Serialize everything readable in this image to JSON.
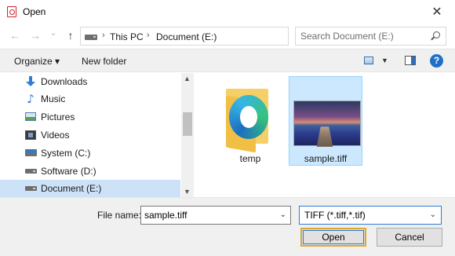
{
  "window": {
    "title": "Open",
    "close_symbol": "✕"
  },
  "nav": {
    "back_symbol": "←",
    "forward_symbol": "→",
    "recent_symbol": "⌄",
    "up_symbol": "↑",
    "breadcrumb": [
      "This PC",
      "Document (E:)"
    ],
    "crumb_separator": "›",
    "dropdown_symbol": "⌄",
    "refresh_symbol": "↻",
    "search_placeholder": "Search Document (E:)"
  },
  "toolbar": {
    "organize_label": "Organize ▾",
    "new_folder_label": "New folder",
    "view_dropdown_symbol": "▼",
    "help_symbol": "?"
  },
  "sidebar": {
    "items": [
      {
        "label": "Downloads",
        "icon": "downloads-icon",
        "selected": false
      },
      {
        "label": "Music",
        "icon": "music-icon",
        "selected": false
      },
      {
        "label": "Pictures",
        "icon": "pictures-icon",
        "selected": false
      },
      {
        "label": "Videos",
        "icon": "videos-icon",
        "selected": false
      },
      {
        "label": "System (C:)",
        "icon": "system-drive-icon",
        "selected": false
      },
      {
        "label": "Software (D:)",
        "icon": "drive-icon",
        "selected": false
      },
      {
        "label": "Document (E:)",
        "icon": "drive-icon",
        "selected": true
      }
    ],
    "scroll_up_symbol": "▲",
    "scroll_down_symbol": "▼"
  },
  "files": [
    {
      "name": "temp",
      "type": "folder",
      "selected": false
    },
    {
      "name": "sample.tiff",
      "type": "image",
      "selected": true
    }
  ],
  "footer": {
    "file_name_label": "File name:",
    "file_name_value": "sample.tiff",
    "file_type_value": "TIFF (*.tiff,*.tif)",
    "dropdown_symbol": "⌄",
    "open_label": "Open",
    "cancel_label": "Cancel"
  },
  "colors": {
    "selection": "#cce8ff",
    "accent_blue": "#2f7ad1",
    "open_focus": "#e0a82b"
  }
}
